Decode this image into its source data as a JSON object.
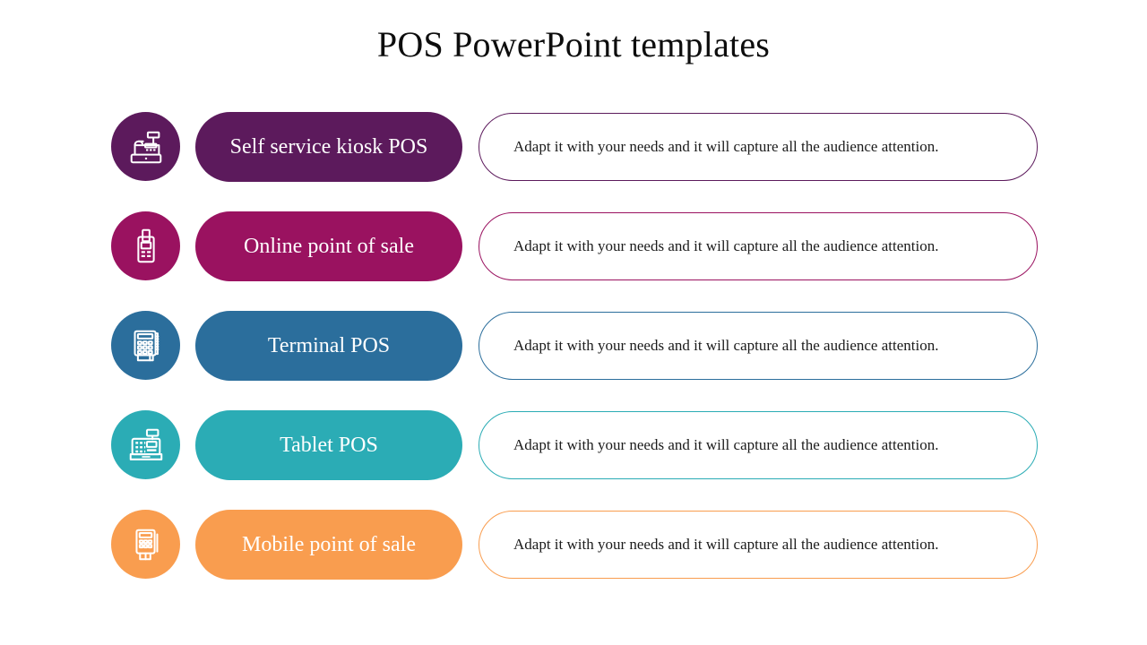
{
  "slide": {
    "title": "POS PowerPoint templates",
    "background_color": "#FFFFFF"
  },
  "rows": [
    {
      "icon": "cash-register-icon",
      "label": "Self service kiosk POS",
      "description": "Adapt it with your needs and it will capture all the audience attention.",
      "color": "#5C1A5C"
    },
    {
      "icon": "card-terminal-icon",
      "label": "Online point of sale",
      "description": "Adapt it with your needs and it will capture all the audience attention.",
      "color": "#9A1260"
    },
    {
      "icon": "pos-terminal-keypad-icon",
      "label": "Terminal POS",
      "description": "Adapt it with your needs and it will capture all the audience attention.",
      "color": "#2B6E9C"
    },
    {
      "icon": "register-display-icon",
      "label": "Tablet POS",
      "description": "Adapt it with your needs and it will capture all the audience attention.",
      "color": "#2BACB5"
    },
    {
      "icon": "mobile-card-reader-icon",
      "label": "Mobile point of sale",
      "description": "Adapt it with your needs and it will capture all the audience attention.",
      "color": "#F99D4F"
    }
  ]
}
